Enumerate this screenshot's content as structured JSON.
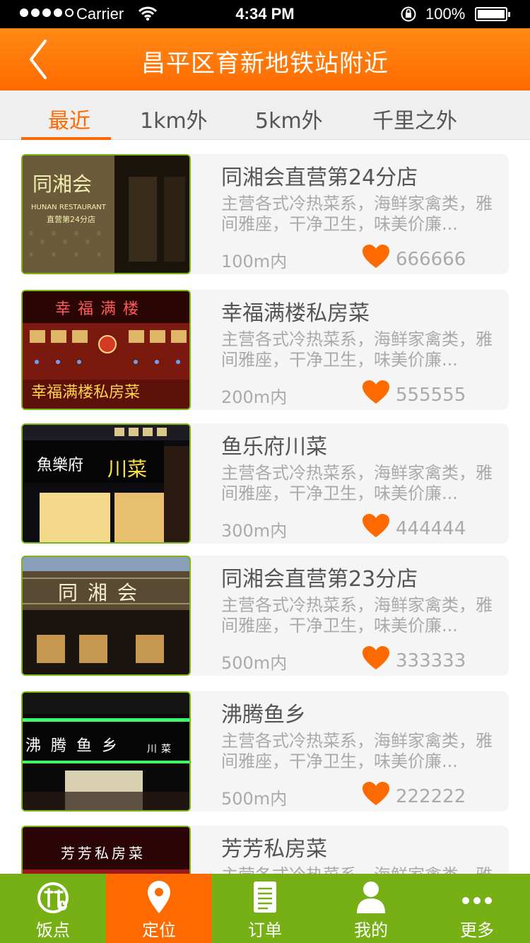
{
  "status_bar": {
    "carrier": "Carrier",
    "time": "4:34 PM",
    "battery": "100%"
  },
  "nav": {
    "title": "昌平区育新地铁站附近"
  },
  "tabs": [
    {
      "label": "最近",
      "active": true
    },
    {
      "label": "1km外",
      "active": false
    },
    {
      "label": "5km外",
      "active": false
    },
    {
      "label": "千里之外",
      "active": false
    }
  ],
  "restaurants": [
    {
      "name": "同湘会直营第24分店",
      "description": "主营各式冷热菜系，海鲜家禽类，雅间雅座，干净卫生，味美价廉...",
      "distance": "100m内",
      "likes": "666666",
      "sign_text": "同湘会",
      "sign_sub": "HUNAN RESTAURANT",
      "sign_sub2": "直营第24分店"
    },
    {
      "name": "幸福满楼私房菜",
      "description": "主营各式冷热菜系，海鲜家禽类，雅间雅座，干净卫生，味美价廉...",
      "distance": "200m内",
      "likes": "555555",
      "sign_text": "幸福满楼",
      "sign_sub": "幸福满楼私房菜",
      "sign_sub2": ""
    },
    {
      "name": "鱼乐府川菜",
      "description": "主营各式冷热菜系，海鲜家禽类，雅间雅座，干净卫生，味美价廉...",
      "distance": "300m内",
      "likes": "444444",
      "sign_text": "魚樂府",
      "sign_sub": "川菜",
      "sign_sub2": ""
    },
    {
      "name": "同湘会直营第23分店",
      "description": "主营各式冷热菜系，海鲜家禽类，雅间雅座，干净卫生，味美价廉...",
      "distance": "500m内",
      "likes": "333333",
      "sign_text": "同湘会",
      "sign_sub": "",
      "sign_sub2": ""
    },
    {
      "name": "沸腾鱼乡",
      "description": "主营各式冷热菜系，海鲜家禽类，雅间雅座，干净卫生，味美价廉...",
      "distance": "500m内",
      "likes": "222222",
      "sign_text": "沸腾鱼乡",
      "sign_sub": "川菜",
      "sign_sub2": ""
    },
    {
      "name": "芳芳私房菜",
      "description": "主营各式冷热菜系，海鲜家禽类，雅间雅座，干净卫生，味美价廉...",
      "distance": "",
      "likes": "",
      "sign_text": "芳芳私房菜",
      "sign_sub": "",
      "sign_sub2": ""
    }
  ],
  "tab_bar": [
    {
      "label": "饭点",
      "icon": "rice-clock-icon",
      "active": false
    },
    {
      "label": "定位",
      "icon": "location-pin-icon",
      "active": true
    },
    {
      "label": "订单",
      "icon": "order-list-icon",
      "active": false
    },
    {
      "label": "我的",
      "icon": "user-icon",
      "active": false
    },
    {
      "label": "更多",
      "icon": "more-dots-icon",
      "active": false
    }
  ],
  "colors": {
    "accent": "#ff6a00",
    "brand_green": "#76b014",
    "heart": "#ff6a00"
  }
}
